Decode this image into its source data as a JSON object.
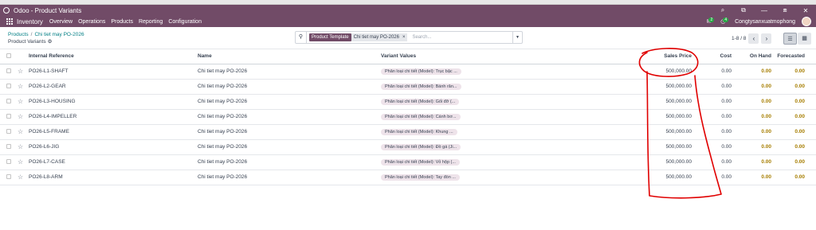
{
  "window": {
    "title": "Odoo - Product Variants",
    "controls": [
      "⌕",
      "⧉",
      "—",
      "⧈",
      "✕"
    ]
  },
  "nav": {
    "app_name": "Inventory",
    "menu": [
      "Overview",
      "Operations",
      "Products",
      "Reporting",
      "Configuration"
    ],
    "messages_badge": "2",
    "activity_badge": "4",
    "company": "Congtysanxuatmophong"
  },
  "breadcrumb": {
    "parent": "Products",
    "separator": "/",
    "record": "Chi tiet may PO-2026",
    "current": "Product Variants"
  },
  "search": {
    "facet_label": "Product Template",
    "facet_value": "Chi tiet may PO-2026",
    "facet_remove": "×",
    "placeholder": "Search..."
  },
  "pager": {
    "text": "1-8 / 8"
  },
  "columns": {
    "reference": "Internal Reference",
    "name": "Name",
    "variant_values": "Variant Values",
    "sales_price": "Sales Price",
    "cost": "Cost",
    "on_hand": "On Hand",
    "forecasted": "Forecasted"
  },
  "rows": [
    {
      "ref": "PO26-L1-SHAFT",
      "name": "Chi tiet may PO-2026",
      "variant": "Phân loại chi tiết (Model): Trục bậc ...",
      "price": "500,000.00",
      "cost": "0.00",
      "on_hand": "0.00",
      "forecasted": "0.00"
    },
    {
      "ref": "PO26-L2-GEAR",
      "name": "Chi tiet may PO-2026",
      "variant": "Phân loại chi tiết (Model): Bánh răn...",
      "price": "500,000.00",
      "cost": "0.00",
      "on_hand": "0.00",
      "forecasted": "0.00"
    },
    {
      "ref": "PO26-L3-HOUSING",
      "name": "Chi tiet may PO-2026",
      "variant": "Phân loại chi tiết (Model): Gối đỡ (...",
      "price": "500,000.00",
      "cost": "0.00",
      "on_hand": "0.00",
      "forecasted": "0.00"
    },
    {
      "ref": "PO26-L4-IMPELLER",
      "name": "Chi tiet may PO-2026",
      "variant": "Phân loại chi tiết (Model): Cánh bơ...",
      "price": "500,000.00",
      "cost": "0.00",
      "on_hand": "0.00",
      "forecasted": "0.00"
    },
    {
      "ref": "PO26-L5-FRAME",
      "name": "Chi tiet may PO-2026",
      "variant": "Phân loại chi tiết (Model): Khung ...",
      "price": "500,000.00",
      "cost": "0.00",
      "on_hand": "0.00",
      "forecasted": "0.00"
    },
    {
      "ref": "PO26-L6-JIG",
      "name": "Chi tiet may PO-2026",
      "variant": "Phân loại chi tiết (Model): Đồ gá (Ji...",
      "price": "500,000.00",
      "cost": "0.00",
      "on_hand": "0.00",
      "forecasted": "0.00"
    },
    {
      "ref": "PO26-L7-CASE",
      "name": "Chi tiet may PO-2026",
      "variant": "Phân loại chi tiết (Model): Vỏ hộp (...",
      "price": "500,000.00",
      "cost": "0.00",
      "on_hand": "0.00",
      "forecasted": "0.00"
    },
    {
      "ref": "PO26-L8-ARM",
      "name": "Chi tiet may PO-2026",
      "variant": "Phân loại chi tiết (Model): Tay đòn ...",
      "price": "500,000.00",
      "cost": "0.00",
      "on_hand": "0.00",
      "forecasted": "0.00"
    }
  ],
  "colors": {
    "brand": "#714b67",
    "link": "#017e84",
    "annotation": "#e00000",
    "stock": "#a67d00"
  }
}
